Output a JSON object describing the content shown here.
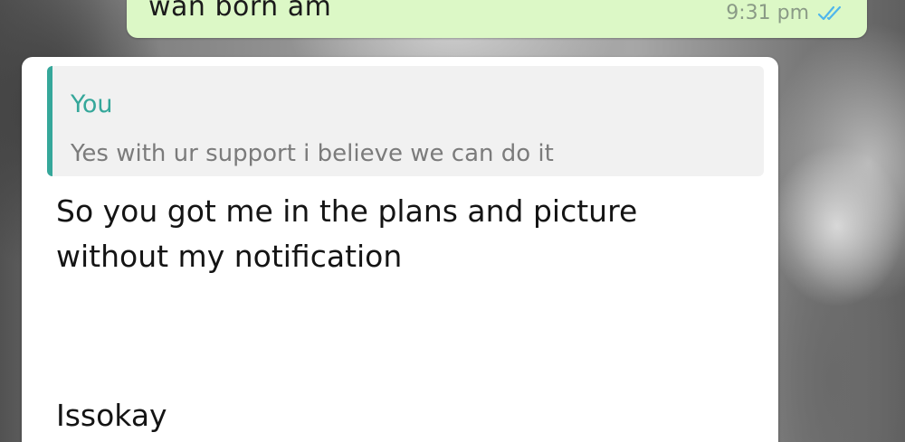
{
  "outgoing_message": {
    "text": "wan born am",
    "time": "9:31 pm",
    "status_icon": "double-check-icon"
  },
  "incoming_message": {
    "quoted_reply": {
      "author": "You",
      "text": "Yes with ur support i believe we can do it"
    },
    "text": "So you got me in the plans and picture without my notification",
    "text_continued": "Issokay"
  },
  "colors": {
    "outgoing_bubble": "#dcf8c6",
    "incoming_bubble": "#ffffff",
    "quote_accent": "#35a79a",
    "tick_blue": "#4fb6ec"
  }
}
